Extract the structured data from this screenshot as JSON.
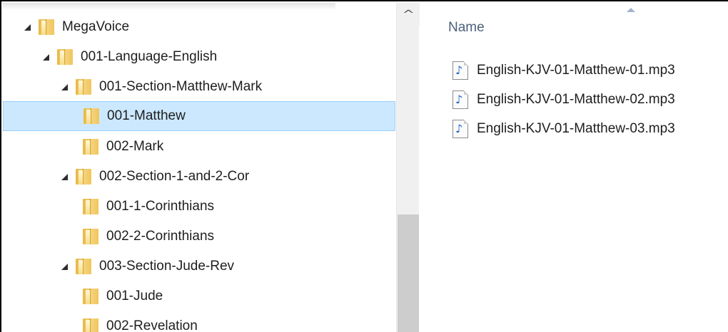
{
  "tree": {
    "items": [
      {
        "label": "MegaVoice",
        "expanded": true
      },
      {
        "label": "001-Language-English",
        "expanded": true
      },
      {
        "label": "001-Section-Matthew-Mark",
        "expanded": true
      },
      {
        "label": "001-Matthew",
        "selected": true
      },
      {
        "label": "002-Mark"
      },
      {
        "label": "002-Section-1-and-2-Cor",
        "expanded": true
      },
      {
        "label": "001-1-Corinthians"
      },
      {
        "label": "002-2-Corinthians"
      },
      {
        "label": "003-Section-Jude-Rev",
        "expanded": true
      },
      {
        "label": "001-Jude"
      },
      {
        "label": "002-Revelation"
      }
    ]
  },
  "scrollbar": {
    "up_arrow_icon": "chevron-up-icon"
  },
  "file_list": {
    "column_name": "Name",
    "sort_direction": "ascending",
    "files": [
      {
        "name": "English-KJV-01-Matthew-01.mp3",
        "icon": "audio-file-icon"
      },
      {
        "name": "English-KJV-01-Matthew-02.mp3",
        "icon": "audio-file-icon"
      },
      {
        "name": "English-KJV-01-Matthew-03.mp3",
        "icon": "audio-file-icon"
      }
    ]
  },
  "colors": {
    "selection_fill": "#cce8ff",
    "selection_border": "#99d1ff",
    "folder_yellow": "#f0c55c",
    "header_text": "#4c607a",
    "audio_note": "#1d64c7"
  }
}
